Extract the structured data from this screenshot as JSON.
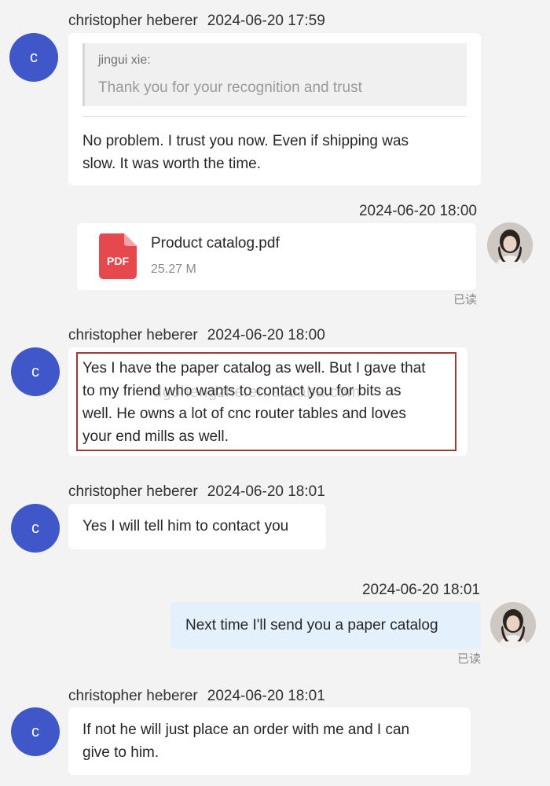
{
  "messages": [
    {
      "sender": "christopher heberer",
      "time": "2024-06-20 17:59",
      "avatar_letter": "c",
      "quote": {
        "name": "jingui xie:",
        "text": "Thank you for your recognition and trust"
      },
      "text_lines": [
        "No problem. I trust you now. Even if shipping was",
        "slow. It was worth the time."
      ]
    },
    {
      "time": "2024-06-20 18:00",
      "file": {
        "icon_label": "PDF",
        "name": "Product catalog.pdf",
        "size": "25.27 M"
      },
      "status": "已读"
    },
    {
      "sender": "christopher heberer",
      "time": "2024-06-20 18:00",
      "avatar_letter": "c",
      "text_lines": [
        "Yes I have the paper catalog as well. But I gave that",
        "to my friend who wants to contact you for bits as",
        "well. He owns a lot of cnc router tables and loves",
        "your end mills as well."
      ],
      "watermark": "dgohengzhe.en.alibaba.com"
    },
    {
      "sender": "christopher heberer",
      "time": "2024-06-20 18:01",
      "avatar_letter": "c",
      "text": "Yes I will tell him to contact you"
    },
    {
      "time": "2024-06-20 18:01",
      "text": "Next time I'll send you a paper catalog",
      "status": "已读"
    },
    {
      "sender": "christopher heberer",
      "time": "2024-06-20 18:01",
      "avatar_letter": "c",
      "text_lines": [
        "If not he will just place an order with me and I can",
        "give to him."
      ]
    }
  ],
  "colors": {
    "avatar": "#3f57c9",
    "outgoing_bubble": "#e4f0fc",
    "pdf_icon": "#e5484d",
    "highlight_border": "#9e3b35"
  }
}
